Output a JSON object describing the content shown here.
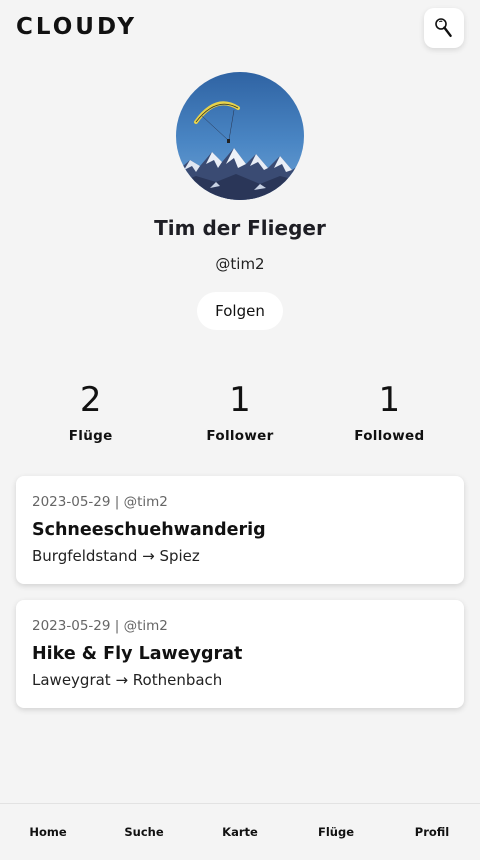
{
  "header": {
    "brand": "CLOUDY",
    "search_icon": "search-icon"
  },
  "profile": {
    "name": "Tim der Flieger",
    "handle": "@tim2",
    "follow_label": "Folgen",
    "avatar": "paraglider-over-mountains"
  },
  "stats": [
    {
      "value": "2",
      "label": "Flüge"
    },
    {
      "value": "1",
      "label": "Follower"
    },
    {
      "value": "1",
      "label": "Followed"
    }
  ],
  "flights": [
    {
      "meta": "2023-05-29 | @tim2",
      "title": "Schneeschuehwanderig",
      "route": "Burgfeldstand → Spiez"
    },
    {
      "meta": "2023-05-29 | @tim2",
      "title": "Hike & Fly Laweygrat",
      "route": "Laweygrat → Rothenbach"
    }
  ],
  "nav": [
    {
      "label": "Home"
    },
    {
      "label": "Suche"
    },
    {
      "label": "Karte"
    },
    {
      "label": "Flüge"
    },
    {
      "label": "Profil"
    }
  ],
  "colors": {
    "background": "#f4f4f4",
    "card": "#ffffff",
    "text": "#111111",
    "muted": "#666666",
    "sky": "#3f78b6"
  }
}
